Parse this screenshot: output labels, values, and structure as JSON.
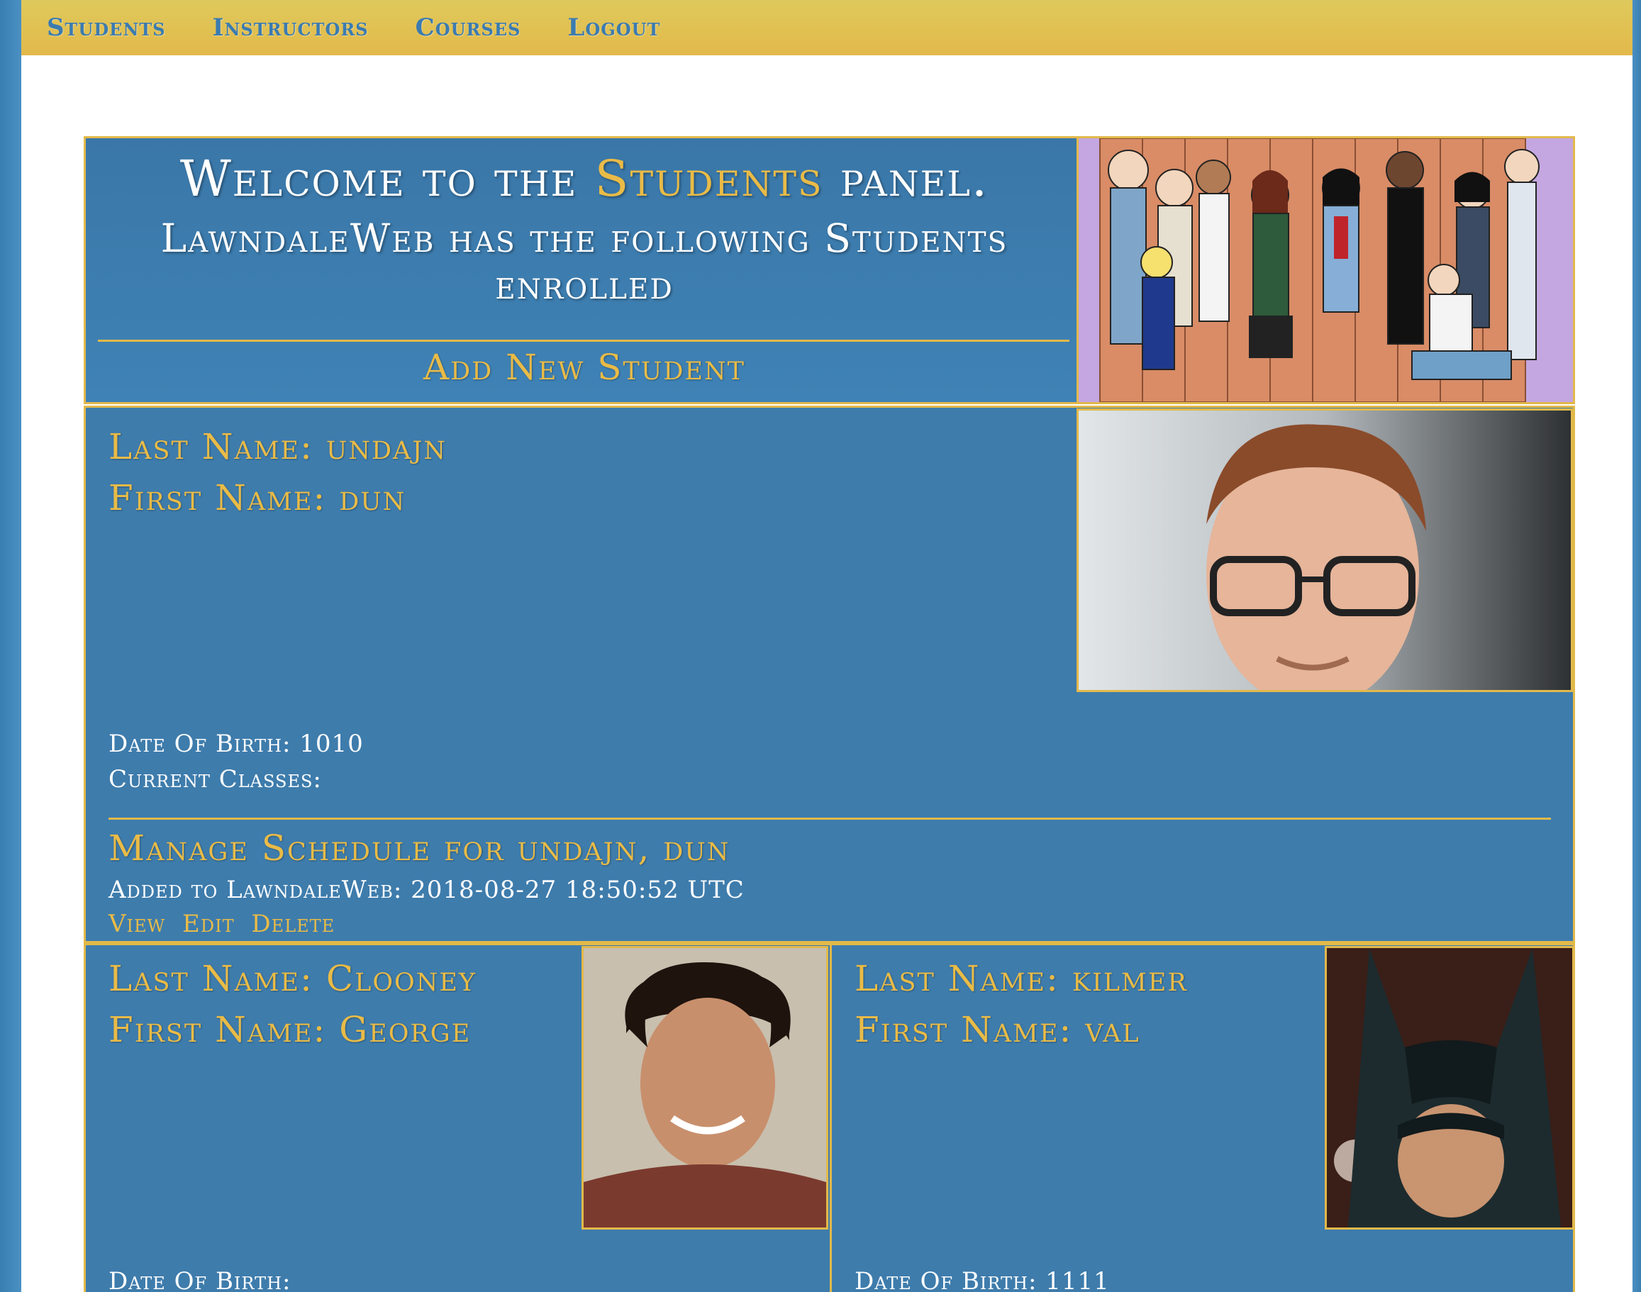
{
  "nav": {
    "items": [
      "Students",
      "Instructors",
      "Courses",
      "Logout"
    ]
  },
  "header": {
    "welcome_prefix": "Welcome to the",
    "welcome_highlight": "Students",
    "welcome_suffix": "panel.",
    "subtitle": "LawndaleWeb has the following Students enrolled",
    "add_new": "Add New Student",
    "banner_icon": "cartoon-cast-image"
  },
  "students": [
    {
      "last_name": "Last Name: undajn",
      "first_name": "First Name: dun",
      "dob": "Date Of Birth: 1010",
      "classes": "Current Classes:",
      "manage": "Manage Schedule for undajn, dun",
      "added": "Added to LawndaleWeb: 2018-08-27 18:50:52 UTC",
      "actions": [
        "View",
        "Edit",
        "Delete"
      ],
      "photo_icon": "portrait-photo"
    },
    {
      "last_name": "Last Name: Clooney",
      "first_name": "First Name: George",
      "dob": "Date Of Birth:",
      "photo_icon": "portrait-photo"
    },
    {
      "last_name": "Last Name: kilmer",
      "first_name": "First Name: val",
      "dob": "Date Of Birth: 1111",
      "photo_icon": "portrait-photo"
    }
  ],
  "colors": {
    "accent_gold": "#e9bb47",
    "panel_blue": "#3e7cac",
    "nav_text": "#3b7bb0"
  }
}
